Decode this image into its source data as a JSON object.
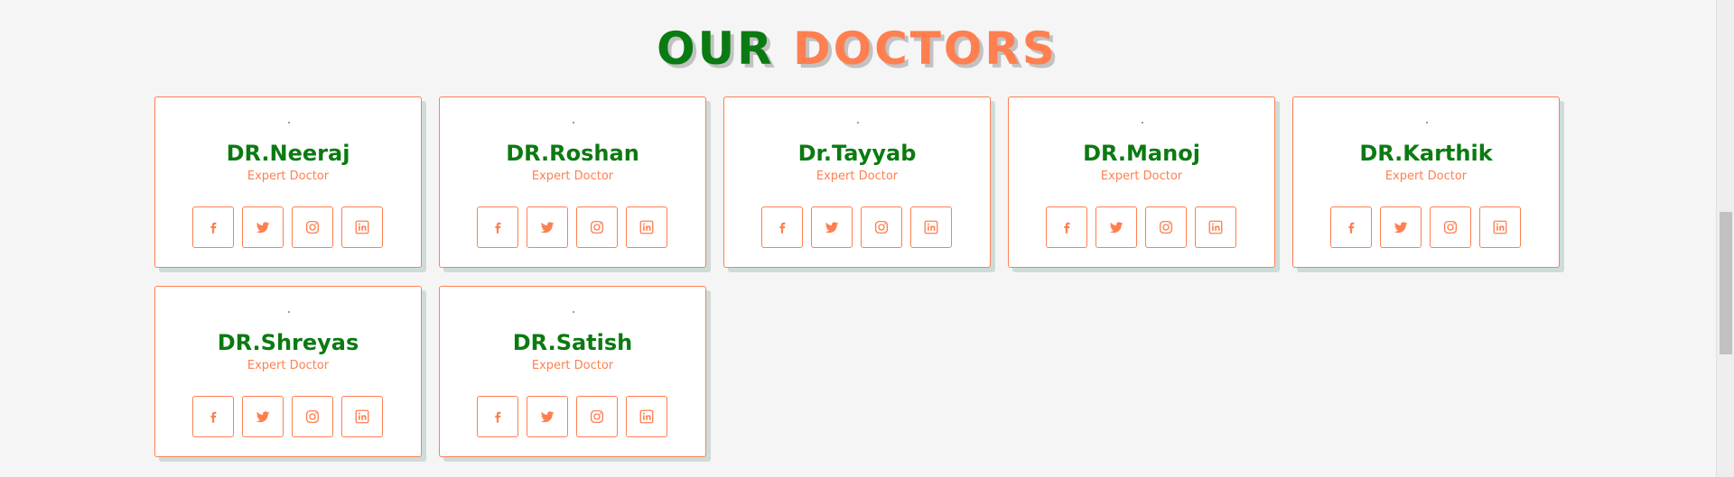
{
  "heading": {
    "word1": "OUR",
    "word2": "DOCTORS",
    "word1_color": "#0b7a12",
    "word2_color": "#ff7f50"
  },
  "doctors": [
    {
      "name": "DR.Neeraj",
      "role": "Expert Doctor"
    },
    {
      "name": "DR.Roshan",
      "role": "Expert Doctor"
    },
    {
      "name": "Dr.Tayyab",
      "role": "Expert Doctor"
    },
    {
      "name": "DR.Manoj",
      "role": "Expert Doctor"
    },
    {
      "name": "DR.Karthik",
      "role": "Expert Doctor"
    },
    {
      "name": "DR.Shreyas",
      "role": "Expert Doctor"
    },
    {
      "name": "DR.Satish",
      "role": "Expert Doctor"
    }
  ],
  "social_icons": [
    "facebook-icon",
    "twitter-icon",
    "instagram-icon",
    "linkedin-icon"
  ],
  "colors": {
    "accent": "#ff7f50",
    "name_green": "#0b7a12",
    "background": "#f5f5f5"
  }
}
